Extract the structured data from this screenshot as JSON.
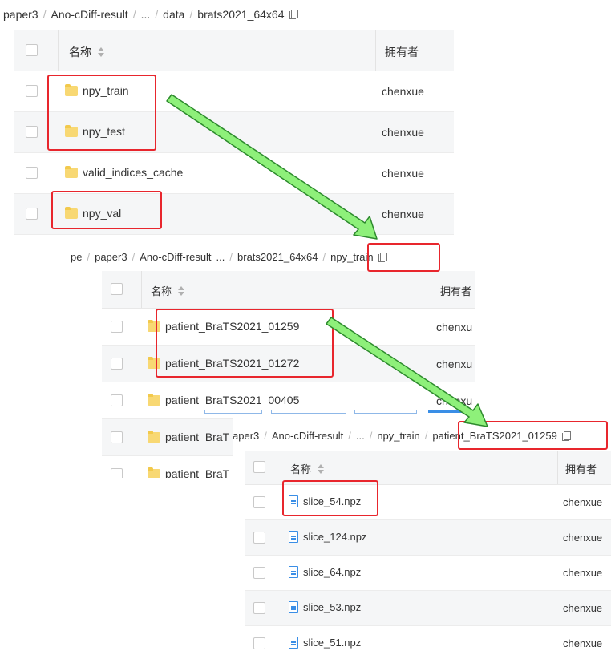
{
  "panel1": {
    "breadcrumb": [
      "paper3",
      "Ano-cDiff-result",
      "...",
      "data",
      "brats2021_64x64"
    ],
    "header": {
      "name": "名称",
      "owner": "拥有者"
    },
    "rows": [
      {
        "name": "npy_train",
        "owner": "chenxue"
      },
      {
        "name": "npy_test",
        "owner": "chenxue"
      },
      {
        "name": "valid_indices_cache",
        "owner": "chenxue"
      },
      {
        "name": "npy_val",
        "owner": "chenxue"
      }
    ]
  },
  "panel2": {
    "breadcrumb": [
      "pe",
      "paper3",
      "Ano-cDiff-result",
      "...",
      "brats2021_64x64",
      "npy_train"
    ],
    "header": {
      "name": "名称",
      "owner": "拥有者"
    },
    "rows": [
      {
        "name": "patient_BraTS2021_01259",
        "owner": "chenxu"
      },
      {
        "name": "patient_BraTS2021_01272",
        "owner": "chenxu"
      },
      {
        "name": "patient_BraTS2021_00405",
        "owner": "chenxu"
      },
      {
        "name": "patient_BraT",
        "owner": ""
      },
      {
        "name": "patient_BraT",
        "owner": ""
      }
    ]
  },
  "panel3": {
    "breadcrumb": [
      "aper3",
      "Ano-cDiff-result",
      "...",
      "npy_train",
      "patient_BraTS2021_01259"
    ],
    "header": {
      "name": "名称",
      "owner": "拥有者"
    },
    "rows": [
      {
        "name": "slice_54.npz",
        "owner": "chenxue"
      },
      {
        "name": "slice_124.npz",
        "owner": "chenxue"
      },
      {
        "name": "slice_64.npz",
        "owner": "chenxue"
      },
      {
        "name": "slice_53.npz",
        "owner": "chenxue"
      },
      {
        "name": "slice_51.npz",
        "owner": "chenxue"
      }
    ]
  },
  "colors": {
    "highlight": "#e8262d",
    "arrow_fill": "#8ef07a",
    "arrow_stroke": "#2d8a2d",
    "file_icon": "#3a8ee6",
    "folder": "#f8d873"
  }
}
